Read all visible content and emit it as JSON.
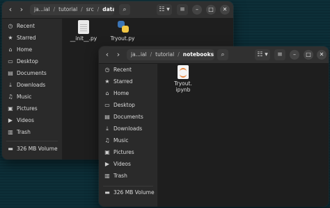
{
  "back_window": {
    "path": [
      "ja...ial",
      "tutorial",
      "src",
      "data"
    ],
    "sidebar": [
      {
        "label": "Recent",
        "icon": "clock-icon"
      },
      {
        "label": "Starred",
        "icon": "star-icon"
      },
      {
        "label": "Home",
        "icon": "home-icon"
      },
      {
        "label": "Desktop",
        "icon": "desktop-icon"
      },
      {
        "label": "Documents",
        "icon": "documents-icon"
      },
      {
        "label": "Downloads",
        "icon": "download-icon"
      },
      {
        "label": "Music",
        "icon": "music-icon"
      },
      {
        "label": "Pictures",
        "icon": "pictures-icon"
      },
      {
        "label": "Videos",
        "icon": "videos-icon"
      },
      {
        "label": "Trash",
        "icon": "trash-icon"
      },
      {
        "label": "326 MB Volume",
        "icon": "drive-icon"
      }
    ],
    "files": [
      {
        "name": "__init__.py",
        "icon": "text-file-icon"
      },
      {
        "name": "Tryout.py",
        "icon": "python-file-icon"
      }
    ]
  },
  "front_window": {
    "path": [
      "ja...ial",
      "tutorial",
      "notebooks"
    ],
    "sidebar": [
      {
        "label": "Recent",
        "icon": "clock-icon"
      },
      {
        "label": "Starred",
        "icon": "star-icon"
      },
      {
        "label": "Home",
        "icon": "home-icon"
      },
      {
        "label": "Desktop",
        "icon": "desktop-icon"
      },
      {
        "label": "Documents",
        "icon": "documents-icon"
      },
      {
        "label": "Downloads",
        "icon": "download-icon"
      },
      {
        "label": "Music",
        "icon": "music-icon"
      },
      {
        "label": "Pictures",
        "icon": "pictures-icon"
      },
      {
        "label": "Videos",
        "icon": "videos-icon"
      },
      {
        "label": "Trash",
        "icon": "trash-icon"
      },
      {
        "label": "326 MB Volume",
        "icon": "drive-icon"
      }
    ],
    "files": [
      {
        "name_line1": "Tryout.",
        "name_line2": "ipynb",
        "icon": "jupyter-notebook-icon"
      }
    ]
  },
  "icons": {
    "back": "‹",
    "forward": "›",
    "search": "⌕",
    "view": "☷",
    "menu": "≡",
    "minimize": "–",
    "maximize": "□",
    "close": "✕",
    "clock-icon": "◷",
    "star-icon": "★",
    "home-icon": "⌂",
    "desktop-icon": "▭",
    "documents-icon": "▤",
    "download-icon": "⤓",
    "music-icon": "♫",
    "pictures-icon": "▣",
    "videos-icon": "▶",
    "trash-icon": "▥",
    "drive-icon": "▬"
  }
}
